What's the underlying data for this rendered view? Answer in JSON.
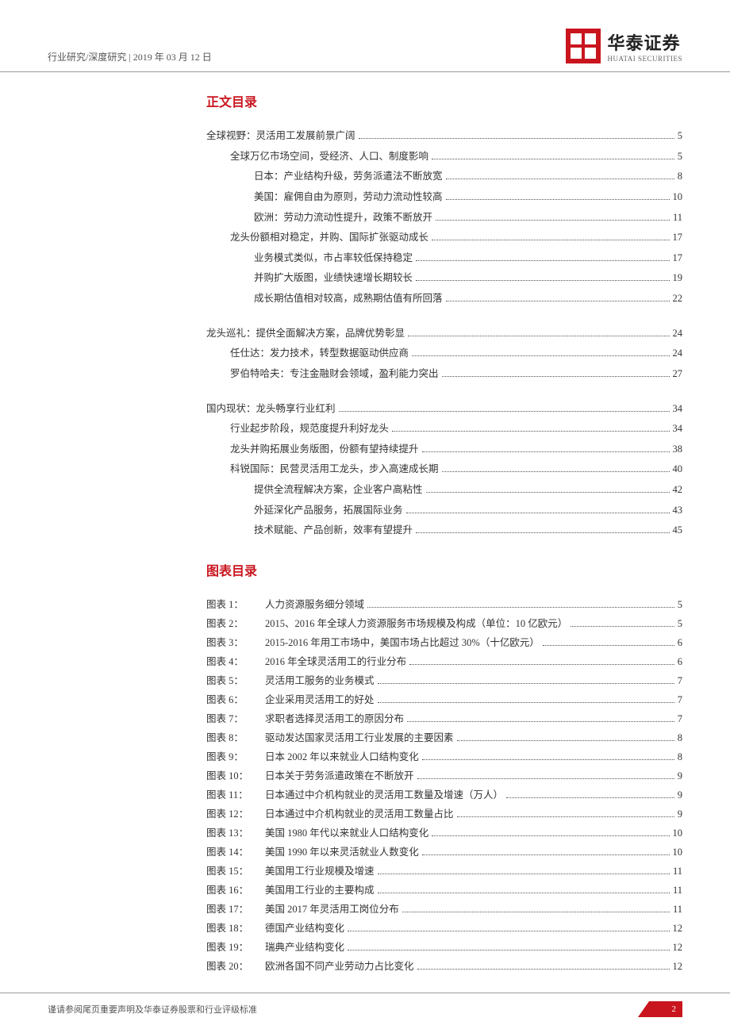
{
  "header": {
    "breadcrumb": "行业研究/深度研究 | 2019 年 03 月 12 日",
    "logo_cn": "华泰证券",
    "logo_en": "HUATAI SECURITIES"
  },
  "sections": {
    "toc_title": "正文目录",
    "figures_title": "图表目录"
  },
  "toc": [
    [
      {
        "indent": 0,
        "label": "全球视野：灵活用工发展前景广阔",
        "page": "5"
      },
      {
        "indent": 1,
        "label": "全球万亿市场空间，受经济、人口、制度影响",
        "page": "5"
      },
      {
        "indent": 2,
        "label": "日本：产业结构升级，劳务派遣法不断放宽",
        "page": "8"
      },
      {
        "indent": 2,
        "label": "美国：雇佣自由为原则，劳动力流动性较高",
        "page": "10"
      },
      {
        "indent": 2,
        "label": "欧洲：劳动力流动性提升，政策不断放开",
        "page": "11"
      },
      {
        "indent": 1,
        "label": "龙头份额相对稳定，并购、国际扩张驱动成长",
        "page": "17"
      },
      {
        "indent": 2,
        "label": "业务模式类似，市占率较低保持稳定",
        "page": "17"
      },
      {
        "indent": 2,
        "label": "并购扩大版图，业绩快速增长期较长",
        "page": "19"
      },
      {
        "indent": 2,
        "label": "成长期估值相对较高，成熟期估值有所回落",
        "page": "22"
      }
    ],
    [
      {
        "indent": 0,
        "label": "龙头巡礼：提供全面解决方案，品牌优势彰显",
        "page": "24"
      },
      {
        "indent": 1,
        "label": "任仕达：发力技术，转型数据驱动供应商",
        "page": "24"
      },
      {
        "indent": 1,
        "label": "罗伯特哈夫：专注金融财会领域，盈利能力突出",
        "page": "27"
      }
    ],
    [
      {
        "indent": 0,
        "label": "国内现状：龙头畅享行业红利",
        "page": "34"
      },
      {
        "indent": 1,
        "label": "行业起步阶段，规范度提升利好龙头",
        "page": "34"
      },
      {
        "indent": 1,
        "label": "龙头并购拓展业务版图，份额有望持续提升",
        "page": "38"
      },
      {
        "indent": 1,
        "label": "科锐国际：民营灵活用工龙头，步入高速成长期",
        "page": "40"
      },
      {
        "indent": 2,
        "label": "提供全流程解决方案，企业客户高粘性",
        "page": "42"
      },
      {
        "indent": 2,
        "label": "外延深化产品服务，拓展国际业务",
        "page": "43"
      },
      {
        "indent": 2,
        "label": "技术赋能、产品创新，效率有望提升",
        "page": "45"
      }
    ]
  ],
  "figures": [
    {
      "prefix": "图表 1：",
      "title": "人力资源服务细分领域",
      "page": "5"
    },
    {
      "prefix": "图表 2：",
      "title": "2015、2016 年全球人力资源服务市场规模及构成（单位：10 亿欧元）",
      "page": "5"
    },
    {
      "prefix": "图表 3：",
      "title": "2015-2016 年用工市场中，美国市场占比超过 30%（十亿欧元）",
      "page": "6"
    },
    {
      "prefix": "图表 4：",
      "title": "2016 年全球灵活用工的行业分布",
      "page": "6"
    },
    {
      "prefix": "图表 5：",
      "title": "灵活用工服务的业务模式",
      "page": "7"
    },
    {
      "prefix": "图表 6：",
      "title": "企业采用灵活用工的好处",
      "page": "7"
    },
    {
      "prefix": "图表 7：",
      "title": "求职者选择灵活用工的原因分布",
      "page": "7"
    },
    {
      "prefix": "图表 8：",
      "title": "驱动发达国家灵活用工行业发展的主要因素",
      "page": "8"
    },
    {
      "prefix": "图表 9：",
      "title": "日本 2002 年以来就业人口结构变化",
      "page": "8"
    },
    {
      "prefix": "图表 10：",
      "title": "日本关于劳务派遣政策在不断放开",
      "page": "9"
    },
    {
      "prefix": "图表 11：",
      "title": "日本通过中介机构就业的灵活用工数量及增速（万人）",
      "page": "9"
    },
    {
      "prefix": "图表 12：",
      "title": "日本通过中介机构就业的灵活用工数量占比",
      "page": "9"
    },
    {
      "prefix": "图表 13：",
      "title": "美国 1980 年代以来就业人口结构变化",
      "page": "10"
    },
    {
      "prefix": "图表 14：",
      "title": "美国 1990 年以来灵活就业人数变化",
      "page": "10"
    },
    {
      "prefix": "图表 15：",
      "title": "美国用工行业规模及增速",
      "page": "11"
    },
    {
      "prefix": "图表 16：",
      "title": "美国用工行业的主要构成",
      "page": "11"
    },
    {
      "prefix": "图表 17：",
      "title": "美国 2017 年灵活用工岗位分布",
      "page": "11"
    },
    {
      "prefix": "图表 18：",
      "title": "德国产业结构变化",
      "page": "12"
    },
    {
      "prefix": "图表 19：",
      "title": "瑞典产业结构变化",
      "page": "12"
    },
    {
      "prefix": "图表 20：",
      "title": "欧洲各国不同产业劳动力占比变化",
      "page": "12"
    }
  ],
  "footer": {
    "disclaimer": "谨请参阅尾页重要声明及华泰证券股票和行业评级标准",
    "page": "2"
  }
}
